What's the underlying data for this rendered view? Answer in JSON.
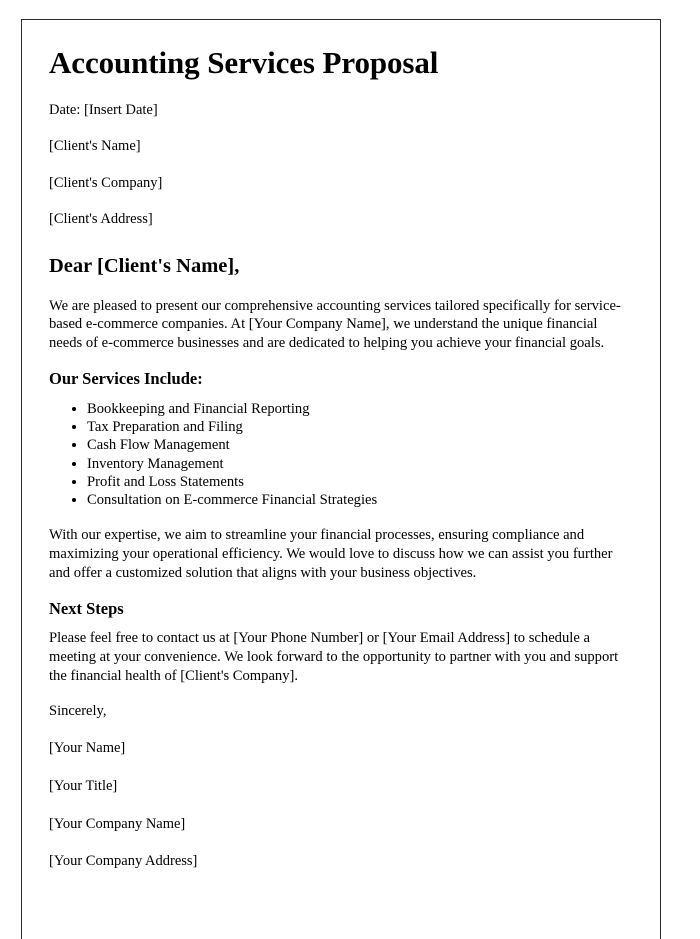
{
  "document": {
    "title": "Accounting Services Proposal",
    "header_lines": [
      "Date: [Insert Date]",
      "[Client's Name]",
      "[Client's Company]",
      "[Client's Address]"
    ],
    "salutation": "Dear [Client's Name],",
    "intro_paragraph": "We are pleased to present our comprehensive accounting services tailored specifically for service-based e-commerce companies. At [Your Company Name], we understand the unique financial needs of e-commerce businesses and are dedicated to helping you achieve your financial goals.",
    "services_heading": "Our Services Include:",
    "services": [
      "Bookkeeping and Financial Reporting",
      "Tax Preparation and Filing",
      "Cash Flow Management",
      "Inventory Management",
      "Profit and Loss Statements",
      "Consultation on E-commerce Financial Strategies"
    ],
    "expertise_paragraph": "With our expertise, we aim to streamline your financial processes, ensuring compliance and maximizing your operational efficiency. We would love to discuss how we can assist you further and offer a customized solution that aligns with your business objectives.",
    "next_steps_heading": "Next Steps",
    "next_steps_paragraph": "Please feel free to contact us at [Your Phone Number] or [Your Email Address] to schedule a meeting at your convenience. We look forward to the opportunity to partner with you and support the financial health of [Client's Company].",
    "closing": "Sincerely,",
    "signature_lines": [
      "[Your Name]",
      "[Your Title]",
      "[Your Company Name]",
      "[Your Company Address]"
    ]
  },
  "colors": {
    "page_background": "#ffffff",
    "text": "#000000",
    "page_border": "#2b2b30"
  }
}
